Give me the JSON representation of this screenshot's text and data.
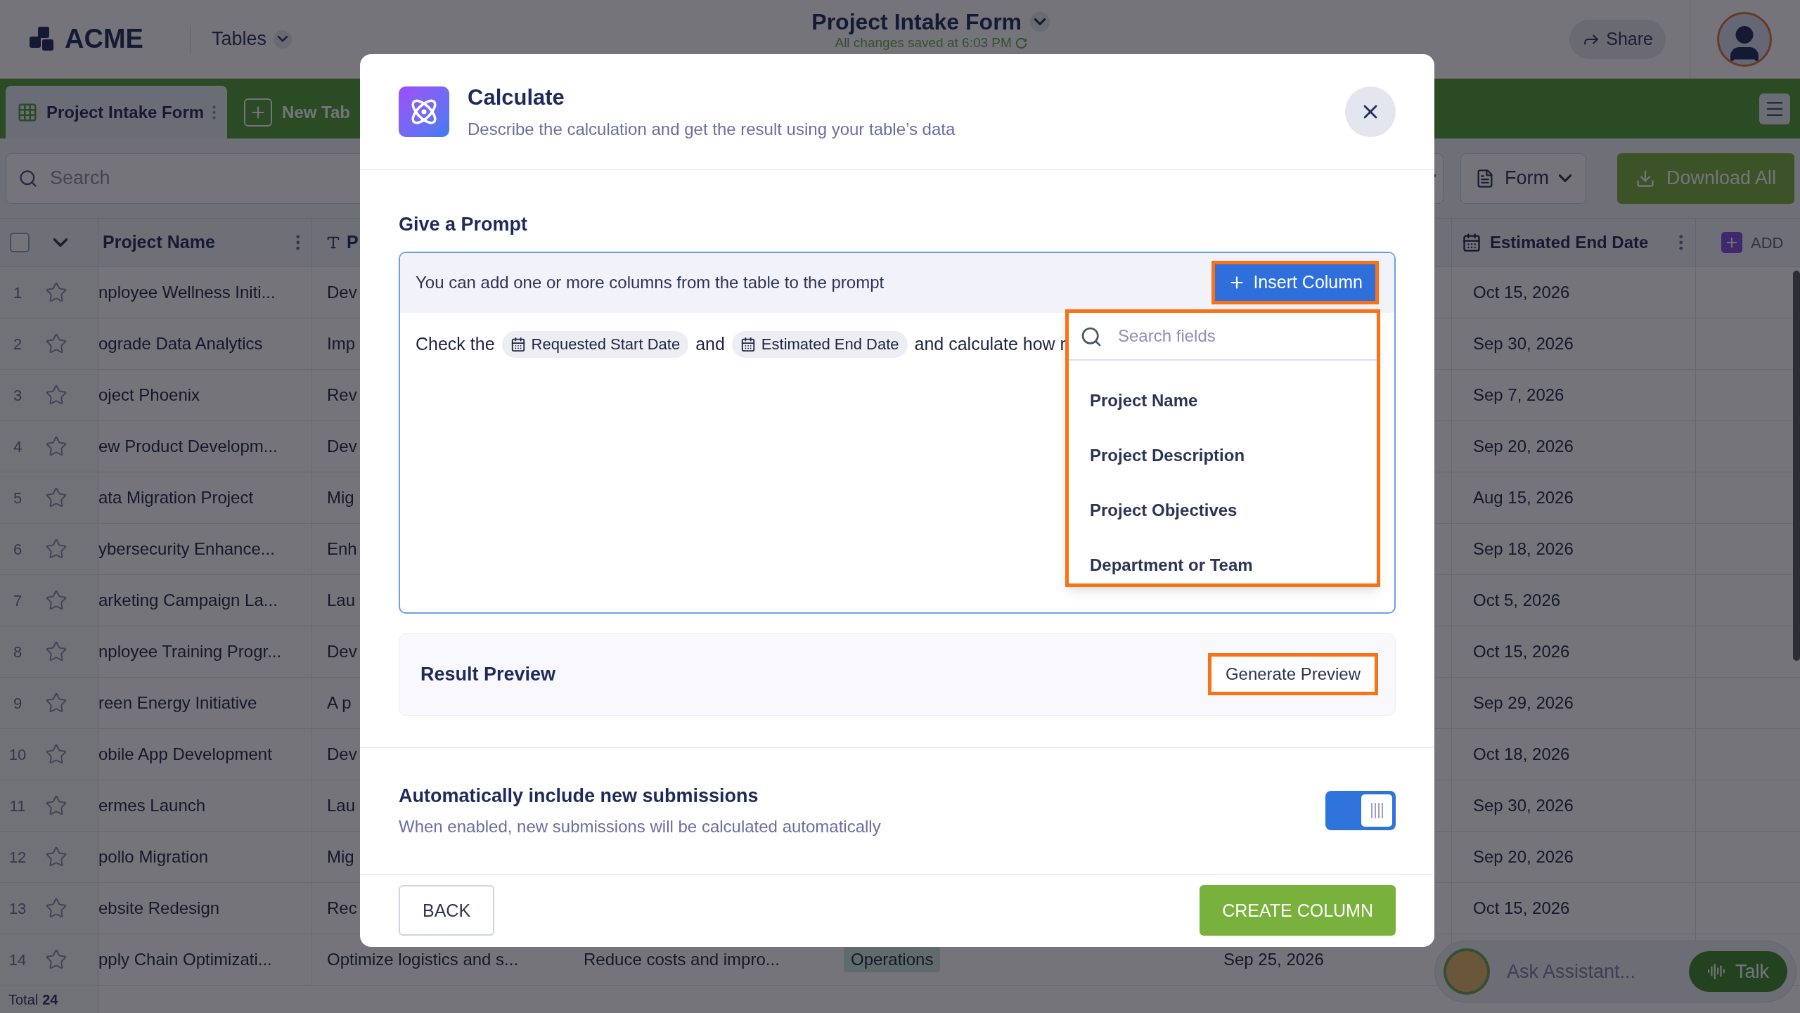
{
  "app": {
    "logo": "ACME",
    "menu": "Tables",
    "title": "Project Intake Form",
    "save_status": "All changes saved at 6:03 PM",
    "share": "Share"
  },
  "tabs": [
    {
      "label": "Project Intake Form",
      "selected": true
    },
    {
      "label": "New Tab",
      "selected": false
    }
  ],
  "toolbar": {
    "search_placeholder": "Search",
    "view": "Form",
    "download": "Download All"
  },
  "table": {
    "columns": [
      {
        "label": "Project Name",
        "kind": "text"
      },
      {
        "label": "P",
        "kind": "long-text"
      },
      {
        "label": "Estimated End Date",
        "kind": "date"
      }
    ],
    "add": "ADD",
    "select_all": {
      "checked": false
    },
    "rows": [
      {
        "number": "1",
        "name": "nployee Wellness Initi...",
        "column_3": "Dev",
        "end_date": "Oct 15, 2026"
      },
      {
        "number": "2",
        "name": "ograde Data Analytics",
        "column_3": "Imp",
        "end_date": "Sep 30, 2026"
      },
      {
        "number": "3",
        "name": "oject Phoenix",
        "column_3": "Rev",
        "end_date": "Sep 7, 2026"
      },
      {
        "number": "4",
        "name": "ew Product Developm...",
        "column_3": "Dev",
        "end_date": "Sep 20, 2026"
      },
      {
        "number": "5",
        "name": "ata Migration Project",
        "column_3": "Mig",
        "end_date": "Aug 15, 2026"
      },
      {
        "number": "6",
        "name": "ybersecurity Enhance...",
        "column_3": "Enh",
        "end_date": "Sep 18, 2026"
      },
      {
        "number": "7",
        "name": "arketing Campaign La...",
        "column_3": "Lau",
        "end_date": "Oct 5, 2026"
      },
      {
        "number": "8",
        "name": "nployee Training Progr...",
        "column_3": "Dev",
        "end_date": "Oct 15, 2026"
      },
      {
        "number": "9",
        "name": "reen Energy Initiative",
        "column_3": "A p",
        "end_date": "Sep 29, 2026"
      },
      {
        "number": "10",
        "name": "obile App Development",
        "column_3": "Dev",
        "end_date": "Oct 18, 2026"
      },
      {
        "number": "11",
        "name": "ermes Launch",
        "column_3": "Lau",
        "end_date": "Sep 30, 2026"
      },
      {
        "number": "12",
        "name": "pollo Migration",
        "column_3": "Mig",
        "end_date": "Sep 20, 2026"
      },
      {
        "number": "13",
        "name": "ebsite Redesign",
        "column_3": "Rec",
        "end_date": "Oct 15, 2026"
      },
      {
        "number": "14",
        "name": "pply Chain Optimizati...",
        "column_3": "Optimize logistics and s...",
        "column_4": "Reduce costs and impro...",
        "column_5": "Operations",
        "column_6": "Sep 25, 2026"
      }
    ],
    "total_label": "Total",
    "total_count": "24"
  },
  "modal": {
    "title": "Calculate",
    "subtitle": "Describe the calculation and get the result using your table’s data",
    "section": "Give a Prompt",
    "hint": "You can add one or more columns from the table to the prompt",
    "insert_button": {
      "label": "Insert Column",
      "highlighted": true
    },
    "prompt": [
      {
        "kind": "text",
        "text": "Check the"
      },
      {
        "kind": "chip",
        "text": "Requested Start Date"
      },
      {
        "kind": "text",
        "text": "and"
      },
      {
        "kind": "chip",
        "text": "Estimated End Date"
      },
      {
        "kind": "text",
        "text": "and calculate how r"
      }
    ],
    "dropdown": {
      "placeholder": "Search fields",
      "highlighted": true,
      "items": [
        "Project Name",
        "Project Description",
        "Project Objectives",
        "Department or Team"
      ]
    },
    "result": {
      "title": "Result Preview",
      "button": "Generate Preview",
      "highlighted": true
    },
    "auto": {
      "title": "Automatically include new submissions",
      "subtitle": "When enabled, new submissions will be calculated automatically",
      "on": true
    },
    "back": "BACK",
    "create": "CREATE COLUMN"
  },
  "assistant": {
    "placeholder": "Ask Assistant...",
    "talk": "Talk"
  }
}
